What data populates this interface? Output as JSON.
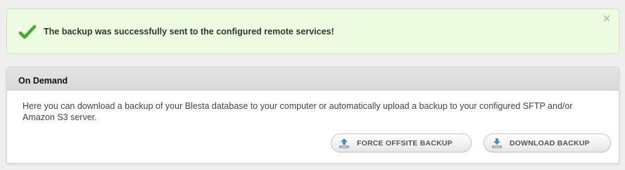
{
  "alert": {
    "message": "The backup was successfully sent to the configured remote services!",
    "close_glyph": "×",
    "check_icon": "checkmark-icon",
    "color": "#3fae29"
  },
  "panel": {
    "title": "On Demand",
    "description": "Here you can download a backup of your Blesta database to your computer or automatically upload a backup to your configured SFTP and/or Amazon S3 server.",
    "buttons": [
      {
        "label": "FORCE OFFSITE BACKUP",
        "icon": "upload-icon"
      },
      {
        "label": "DOWNLOAD BACKUP",
        "icon": "download-icon"
      }
    ]
  },
  "colors": {
    "alert_bg": "#edfbe0",
    "page_bg": "#efefef",
    "icon_blue": "#3b8fd1"
  }
}
